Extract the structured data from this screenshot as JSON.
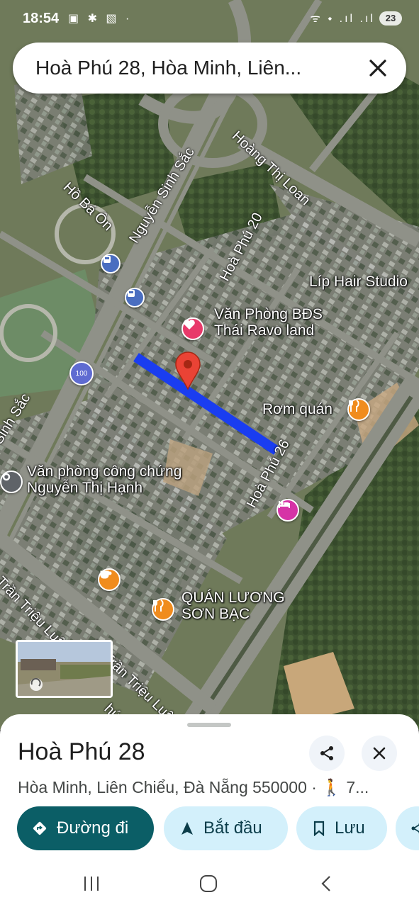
{
  "status_bar": {
    "time": "18:54",
    "left_icons": "▣ ✱ ▧ ·",
    "right_icons": "ᯤ ⬩ .ıl .ıl",
    "battery": "23"
  },
  "search": {
    "query": "Hoà Phú 28, Hòa Minh, Liên..."
  },
  "map": {
    "roads": {
      "nguyen_sinh_sac": "Nguyễn Sinh Sắc",
      "sinh_sac": "Sinh Sắc",
      "hoang_thi_loan": "Hoàng Thị Loan",
      "ho_ba_on": "Hồ Bá Ôn",
      "hoa_phu_20": "Hoà Phú 20",
      "hoa_phu_26": "Hoà Phú 26",
      "tran_trieu_luat": "Trần Triệu Luật",
      "d_tran_trieu_luat": "Đ. Trần Triệu Luật",
      "partial_bottom": "hú 2"
    },
    "places": {
      "lip_hair": "Líp Hair Studio",
      "van_phong_bds_1": "Văn Phòng BĐS",
      "van_phong_bds_2": "Thái Ravo land",
      "rom_quan": "Rơm quán",
      "cong_chung_1": "Văn phòng công chứng",
      "cong_chung_2": "Nguyễn Thị Hạnh",
      "quan_luong_1": "QUÁN LƯƠNG",
      "quan_luong_2": "SƠN BẠC",
      "route_badge": "100"
    },
    "colors": {
      "route": "#1a3df0",
      "pin": "#ea4335",
      "food": "#f08c1e",
      "hotel": "#d633a6",
      "heart": "#e8396a"
    }
  },
  "sheet": {
    "title": "Hoà Phú 28",
    "address": "Hòa Minh, Liên Chiểu, Đà Nẵng 550000 · 🚶 7...",
    "buttons": {
      "directions": "Đường đi",
      "start": "Bắt đầu",
      "save": "Lưu"
    },
    "colors": {
      "primary": "#0b5e66",
      "chip": "#d3f0fb"
    }
  }
}
